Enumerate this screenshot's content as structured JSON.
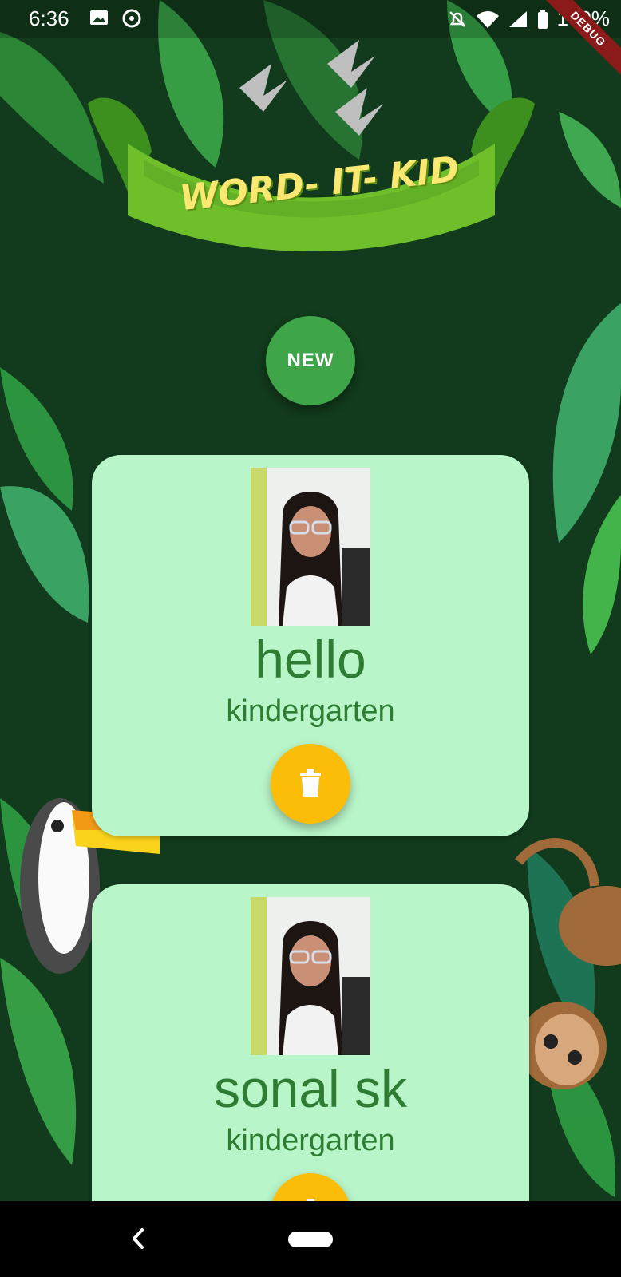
{
  "status_bar": {
    "time": "6:36",
    "battery": "100%",
    "debug_label": "DEBUG"
  },
  "banner": {
    "title": "WORD- IT- KID"
  },
  "new_button": {
    "label": "NEW"
  },
  "cards": [
    {
      "name": "hello",
      "grade": "kindergarten"
    },
    {
      "name": "sonal sk",
      "grade": "kindergarten"
    }
  ],
  "icons": {
    "gallery": "image-icon",
    "sync": "sync-icon",
    "bell": "bell-off-icon",
    "wifi": "wifi-icon",
    "signal": "signal-icon",
    "battery": "battery-icon",
    "delete": "trash-icon",
    "back": "back-chevron-icon"
  },
  "colors": {
    "background": "#123a1c",
    "card": "#b8f5c8",
    "card_text": "#2f7d32",
    "new_button": "#3fa549",
    "delete_button": "#fbbd08"
  }
}
